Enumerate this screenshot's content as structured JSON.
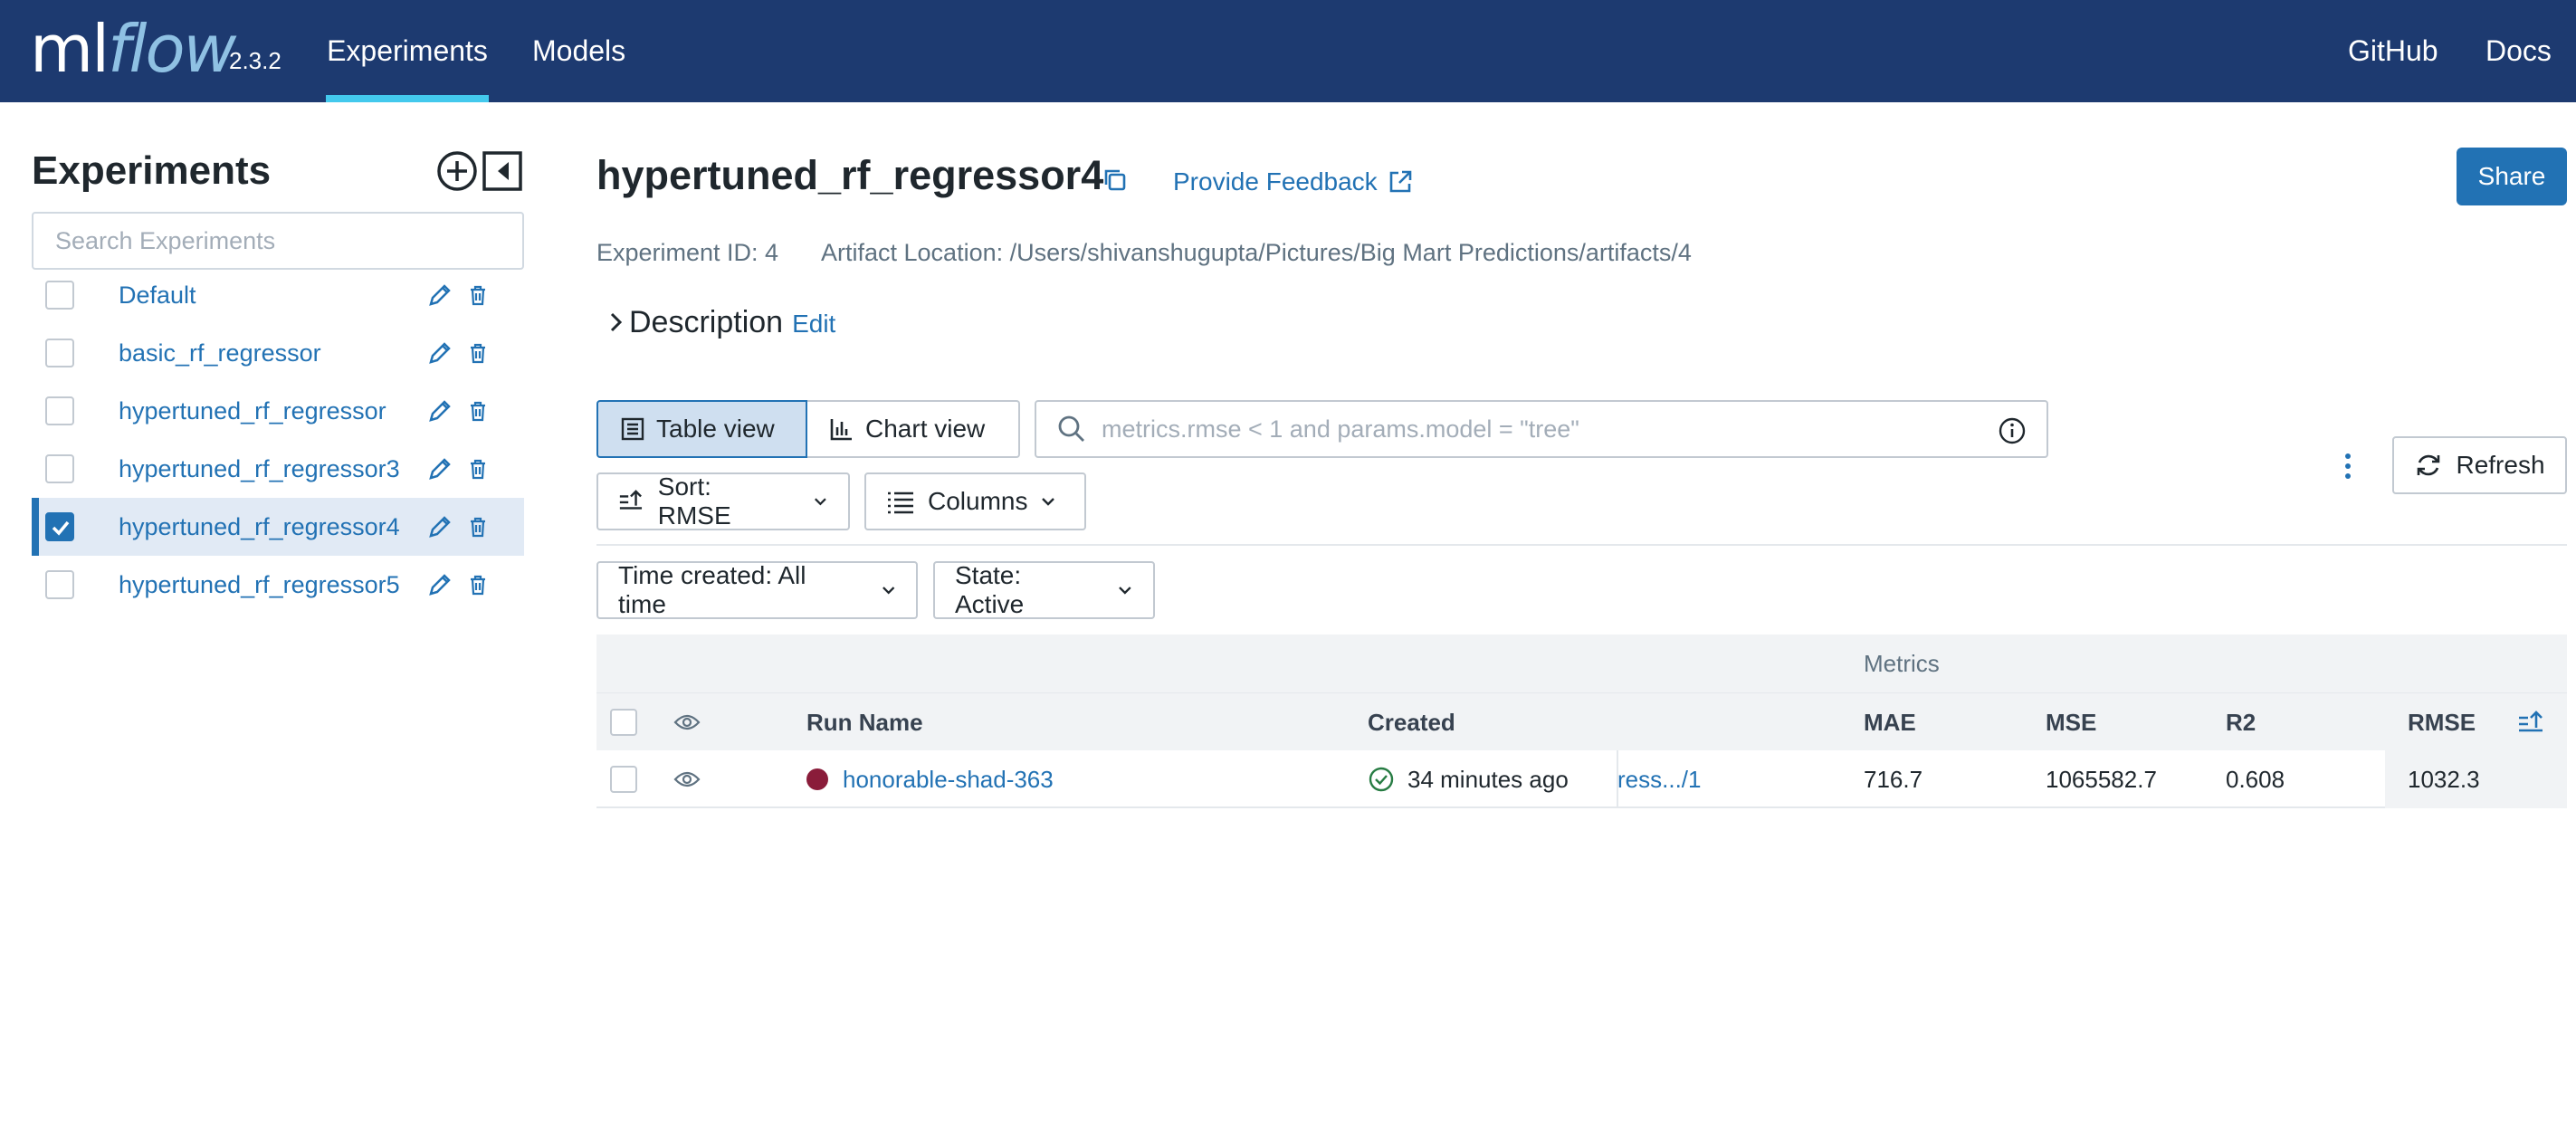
{
  "header": {
    "logo_ml": "ml",
    "logo_flow": "flow",
    "version": "2.3.2",
    "tabs": [
      {
        "label": "Experiments",
        "active": true
      },
      {
        "label": "Models",
        "active": false
      }
    ],
    "links": [
      {
        "label": "GitHub"
      },
      {
        "label": "Docs"
      }
    ]
  },
  "sidebar": {
    "title": "Experiments",
    "search_placeholder": "Search Experiments",
    "experiments": [
      {
        "name": "Default",
        "selected": false
      },
      {
        "name": "basic_rf_regressor",
        "selected": false
      },
      {
        "name": "hypertuned_rf_regressor",
        "selected": false
      },
      {
        "name": "hypertuned_rf_regressor3",
        "selected": false
      },
      {
        "name": "hypertuned_rf_regressor4",
        "selected": true
      },
      {
        "name": "hypertuned_rf_regressor5",
        "selected": false
      }
    ]
  },
  "main": {
    "title": "hypertuned_rf_regressor4",
    "feedback_label": "Provide Feedback",
    "share_label": "Share",
    "experiment_id": "Experiment ID: 4",
    "artifact_location": "Artifact Location: /Users/shivanshugupta/Pictures/Big Mart Predictions/artifacts/4",
    "description_label": "Description",
    "description_edit": "Edit",
    "views": {
      "table": "Table view",
      "chart": "Chart view"
    },
    "filter_placeholder": "metrics.rmse < 1 and params.model = \"tree\"",
    "refresh_label": "Refresh",
    "sort_label": "Sort: RMSE",
    "columns_label": "Columns",
    "time_filter": "Time created: All time",
    "state_filter": "State: Active"
  },
  "table": {
    "group_label": "Metrics",
    "headers": {
      "run_name": "Run Name",
      "created": "Created",
      "mae": "MAE",
      "mse": "MSE",
      "r2": "R2",
      "rmse": "RMSE"
    },
    "rows": [
      {
        "run_name": "honorable-shad-363",
        "created": "34 minutes ago",
        "truncated": "ress.../1",
        "mae": "716.7",
        "mse": "1065582.7",
        "r2": "0.608",
        "rmse": "1032.3",
        "color": "#8a1c3a"
      }
    ]
  },
  "colors": {
    "header_bg": "#1d3a70",
    "accent": "#2272b4",
    "tab_underline": "#43c9ed",
    "success": "#277c43"
  }
}
